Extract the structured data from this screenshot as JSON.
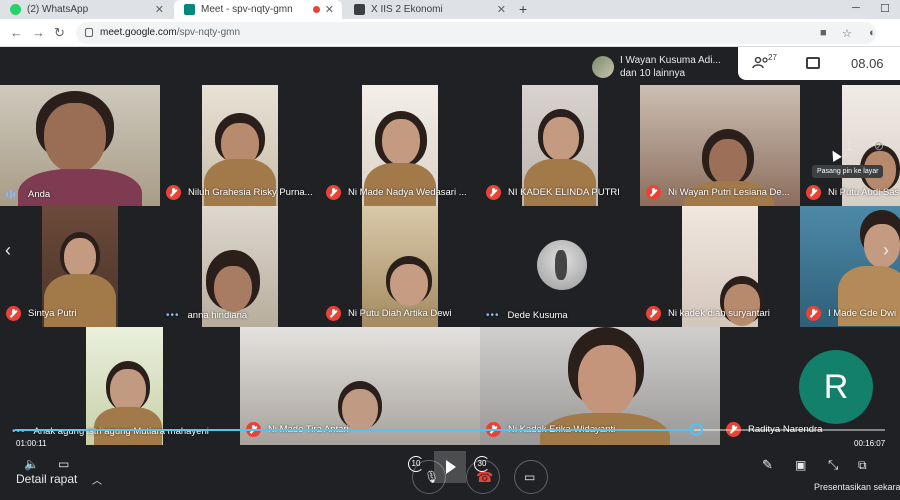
{
  "browser": {
    "tabs": [
      {
        "title": "(2) WhatsApp",
        "icon": "whatsapp-icon",
        "color": "#25d366"
      },
      {
        "title": "Meet - spv-nqty-gmn",
        "icon": "meet-icon",
        "color": "#00897b"
      },
      {
        "title": "X IIS 2 Ekonomi",
        "icon": "classroom-icon",
        "color": "#3c4043"
      }
    ],
    "new_tab": "+",
    "url_host": "meet.google.com",
    "url_path": "/spv-nqty-gmn"
  },
  "meet": {
    "presenter_line1": "I Wayan Kusuma Adi...",
    "presenter_line2": "dan 10 lainnya",
    "people_count": "27",
    "clock": "08.06",
    "pin_tooltip": "Pasang pin ke layar",
    "participants": [
      {
        "name": "Anda",
        "status": "speaking"
      },
      {
        "name": "Niluh Grahesia Risky Purna...",
        "status": "muted"
      },
      {
        "name": "Ni Made Nadya Wedasari ...",
        "status": "muted"
      },
      {
        "name": "NI KADEK ELINDA PUTRI",
        "status": "muted"
      },
      {
        "name": "Ni Wayan Putri Lesiana De...",
        "status": "muted"
      },
      {
        "name": "Ni Putu Audi Sas",
        "status": "muted"
      },
      {
        "name": "Sintya Putri",
        "status": "muted"
      },
      {
        "name": "anna hindiana",
        "status": "active"
      },
      {
        "name": "Ni Putu Diah Artika Dewi",
        "status": "muted"
      },
      {
        "name": "Dede Kusuma",
        "status": "active"
      },
      {
        "name": "Ni kadek diah suryantari",
        "status": "muted"
      },
      {
        "name": "I Made Gde Dwi",
        "status": "muted"
      },
      {
        "name": "Anak agung istri agung Mutiara mahayeni",
        "status": "active"
      },
      {
        "name": "Ni Made Tira Antari",
        "status": "muted"
      },
      {
        "name": "Ni Kadek Erika Widayanti",
        "status": "muted"
      },
      {
        "name": "Raditya Narendra",
        "status": "muted"
      }
    ],
    "avatar_letter": "R"
  },
  "player": {
    "time_elapsed": "01:00:11",
    "time_total": "00:16:07",
    "progress": 0.78,
    "skip_back": "10",
    "skip_forward": "30",
    "details_label": "Detail rapat",
    "present_label": "Presentasikan sekarang"
  },
  "colors": {
    "accent": "#8ab4f8",
    "mute_red": "#ea4335",
    "progress_blue": "#4fc3f7",
    "avatar_green": "#12806b"
  }
}
